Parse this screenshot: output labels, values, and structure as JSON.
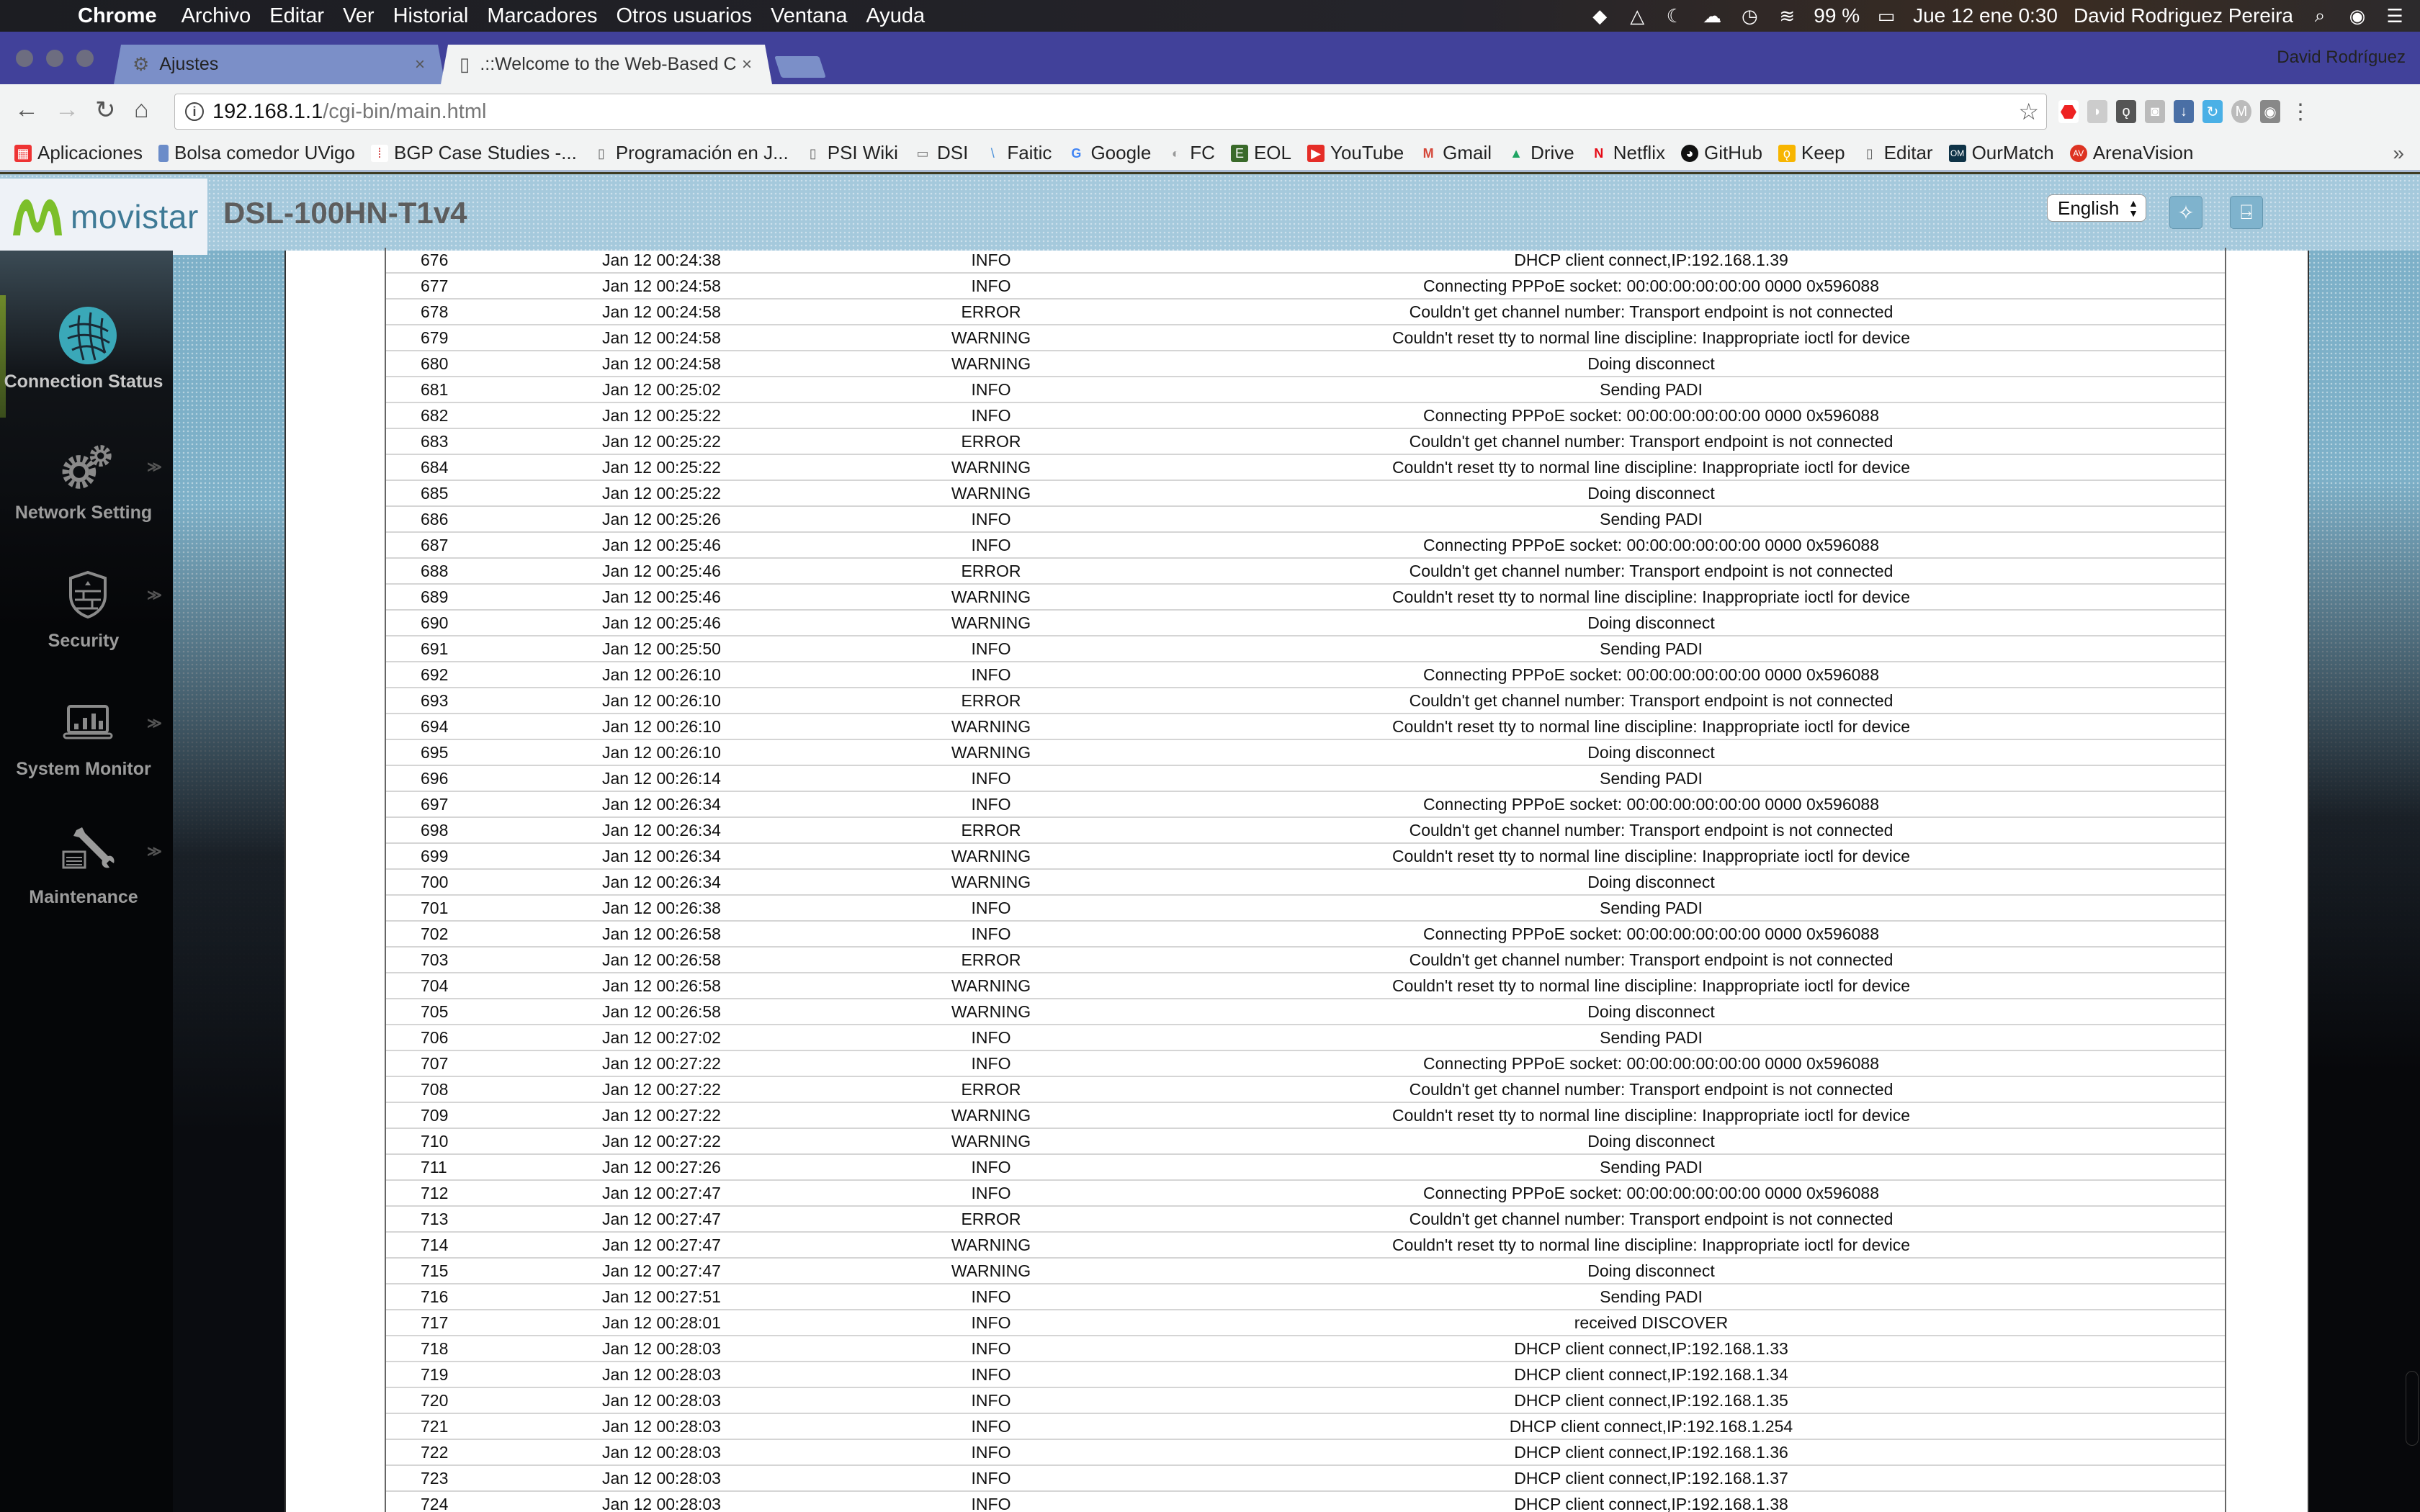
{
  "menubar": {
    "app": "Chrome",
    "items": [
      "Archivo",
      "Editar",
      "Ver",
      "Historial",
      "Marcadores",
      "Otros usuarios",
      "Ventana",
      "Ayuda"
    ],
    "battery": "99 %",
    "datetime": "Jue 12 ene  0:30",
    "user": "David Rodriguez Pereira"
  },
  "browser": {
    "tabs": [
      {
        "label": "Ajustes",
        "icon": "gear-icon",
        "active": false
      },
      {
        "label": ".::Welcome to the Web-Based C",
        "icon": "page-icon",
        "active": true
      }
    ],
    "profile_name": "David Rodríguez",
    "url_host": "192.168.1.1",
    "url_path": "/cgi-bin/main.html",
    "bookmarks": [
      {
        "label": "Aplicaciones",
        "icon": "apps-grid-icon",
        "color": "#e33"
      },
      {
        "label": "Bolsa comedor UVigo",
        "icon": "uvigo-icon",
        "color": "#6b8cc9"
      },
      {
        "label": "BGP Case Studies -...",
        "icon": "cisco-icon",
        "color": "#c33"
      },
      {
        "label": "Programación en J...",
        "icon": "page-icon",
        "color": "#999"
      },
      {
        "label": "PSI Wiki",
        "icon": "page-icon",
        "color": "#999"
      },
      {
        "label": "DSI",
        "icon": "folder-icon",
        "color": "#888"
      },
      {
        "label": "Faitic",
        "icon": "faitic-icon",
        "color": "#4a90d9"
      },
      {
        "label": "Google",
        "icon": "google-icon",
        "color": "#4285f4"
      },
      {
        "label": "FC",
        "icon": "fc-icon",
        "color": "#999"
      },
      {
        "label": "EOL",
        "icon": "eol-icon",
        "color": "#3a6a2a"
      },
      {
        "label": "YouTube",
        "icon": "youtube-icon",
        "color": "#e52d27"
      },
      {
        "label": "Gmail",
        "icon": "gmail-icon",
        "color": "#d44638"
      },
      {
        "label": "Drive",
        "icon": "drive-icon",
        "color": "#1fa463"
      },
      {
        "label": "Netflix",
        "icon": "netflix-icon",
        "color": "#e50914"
      },
      {
        "label": "GitHub",
        "icon": "github-icon",
        "color": "#111"
      },
      {
        "label": "Keep",
        "icon": "keep-icon",
        "color": "#f7b500"
      },
      {
        "label": "Editar",
        "icon": "page-icon",
        "color": "#999"
      },
      {
        "label": "OurMatch",
        "icon": "ourmatch-icon",
        "color": "#0f3347"
      },
      {
        "label": "ArenaVision",
        "icon": "arenavision-icon",
        "color": "#d32"
      }
    ]
  },
  "router": {
    "brand": "movistar",
    "model": "DSL-100HN-T1v4",
    "language": "English",
    "wizard_icon": "wizard-wand-icon",
    "logout_icon": "logout-door-icon",
    "sidebar": [
      {
        "label": "Connection Status",
        "icon": "globe-icon",
        "active": true
      },
      {
        "label": "Network Setting",
        "icon": "gears-icon",
        "active": false
      },
      {
        "label": "Security",
        "icon": "shield-firewall-icon",
        "active": false
      },
      {
        "label": "System Monitor",
        "icon": "laptop-chart-icon",
        "active": false
      },
      {
        "label": "Maintenance",
        "icon": "wrench-icon",
        "active": false
      }
    ],
    "log_rows": [
      {
        "id": "676",
        "time": "Jan 12 00:24:38",
        "level": "INFO",
        "message": "DHCP client connect,IP:192.168.1.39"
      },
      {
        "id": "677",
        "time": "Jan 12 00:24:58",
        "level": "INFO",
        "message": "Connecting PPPoE socket: 00:00:00:00:00:00 0000 0x596088"
      },
      {
        "id": "678",
        "time": "Jan 12 00:24:58",
        "level": "ERROR",
        "message": "Couldn't get channel number: Transport endpoint is not connected"
      },
      {
        "id": "679",
        "time": "Jan 12 00:24:58",
        "level": "WARNING",
        "message": "Couldn't reset tty to normal line discipline: Inappropriate ioctl for device"
      },
      {
        "id": "680",
        "time": "Jan 12 00:24:58",
        "level": "WARNING",
        "message": "Doing disconnect"
      },
      {
        "id": "681",
        "time": "Jan 12 00:25:02",
        "level": "INFO",
        "message": "Sending PADI"
      },
      {
        "id": "682",
        "time": "Jan 12 00:25:22",
        "level": "INFO",
        "message": "Connecting PPPoE socket: 00:00:00:00:00:00 0000 0x596088"
      },
      {
        "id": "683",
        "time": "Jan 12 00:25:22",
        "level": "ERROR",
        "message": "Couldn't get channel number: Transport endpoint is not connected"
      },
      {
        "id": "684",
        "time": "Jan 12 00:25:22",
        "level": "WARNING",
        "message": "Couldn't reset tty to normal line discipline: Inappropriate ioctl for device"
      },
      {
        "id": "685",
        "time": "Jan 12 00:25:22",
        "level": "WARNING",
        "message": "Doing disconnect"
      },
      {
        "id": "686",
        "time": "Jan 12 00:25:26",
        "level": "INFO",
        "message": "Sending PADI"
      },
      {
        "id": "687",
        "time": "Jan 12 00:25:46",
        "level": "INFO",
        "message": "Connecting PPPoE socket: 00:00:00:00:00:00 0000 0x596088"
      },
      {
        "id": "688",
        "time": "Jan 12 00:25:46",
        "level": "ERROR",
        "message": "Couldn't get channel number: Transport endpoint is not connected"
      },
      {
        "id": "689",
        "time": "Jan 12 00:25:46",
        "level": "WARNING",
        "message": "Couldn't reset tty to normal line discipline: Inappropriate ioctl for device"
      },
      {
        "id": "690",
        "time": "Jan 12 00:25:46",
        "level": "WARNING",
        "message": "Doing disconnect"
      },
      {
        "id": "691",
        "time": "Jan 12 00:25:50",
        "level": "INFO",
        "message": "Sending PADI"
      },
      {
        "id": "692",
        "time": "Jan 12 00:26:10",
        "level": "INFO",
        "message": "Connecting PPPoE socket: 00:00:00:00:00:00 0000 0x596088"
      },
      {
        "id": "693",
        "time": "Jan 12 00:26:10",
        "level": "ERROR",
        "message": "Couldn't get channel number: Transport endpoint is not connected"
      },
      {
        "id": "694",
        "time": "Jan 12 00:26:10",
        "level": "WARNING",
        "message": "Couldn't reset tty to normal line discipline: Inappropriate ioctl for device"
      },
      {
        "id": "695",
        "time": "Jan 12 00:26:10",
        "level": "WARNING",
        "message": "Doing disconnect"
      },
      {
        "id": "696",
        "time": "Jan 12 00:26:14",
        "level": "INFO",
        "message": "Sending PADI"
      },
      {
        "id": "697",
        "time": "Jan 12 00:26:34",
        "level": "INFO",
        "message": "Connecting PPPoE socket: 00:00:00:00:00:00 0000 0x596088"
      },
      {
        "id": "698",
        "time": "Jan 12 00:26:34",
        "level": "ERROR",
        "message": "Couldn't get channel number: Transport endpoint is not connected"
      },
      {
        "id": "699",
        "time": "Jan 12 00:26:34",
        "level": "WARNING",
        "message": "Couldn't reset tty to normal line discipline: Inappropriate ioctl for device"
      },
      {
        "id": "700",
        "time": "Jan 12 00:26:34",
        "level": "WARNING",
        "message": "Doing disconnect"
      },
      {
        "id": "701",
        "time": "Jan 12 00:26:38",
        "level": "INFO",
        "message": "Sending PADI"
      },
      {
        "id": "702",
        "time": "Jan 12 00:26:58",
        "level": "INFO",
        "message": "Connecting PPPoE socket: 00:00:00:00:00:00 0000 0x596088"
      },
      {
        "id": "703",
        "time": "Jan 12 00:26:58",
        "level": "ERROR",
        "message": "Couldn't get channel number: Transport endpoint is not connected"
      },
      {
        "id": "704",
        "time": "Jan 12 00:26:58",
        "level": "WARNING",
        "message": "Couldn't reset tty to normal line discipline: Inappropriate ioctl for device"
      },
      {
        "id": "705",
        "time": "Jan 12 00:26:58",
        "level": "WARNING",
        "message": "Doing disconnect"
      },
      {
        "id": "706",
        "time": "Jan 12 00:27:02",
        "level": "INFO",
        "message": "Sending PADI"
      },
      {
        "id": "707",
        "time": "Jan 12 00:27:22",
        "level": "INFO",
        "message": "Connecting PPPoE socket: 00:00:00:00:00:00 0000 0x596088"
      },
      {
        "id": "708",
        "time": "Jan 12 00:27:22",
        "level": "ERROR",
        "message": "Couldn't get channel number: Transport endpoint is not connected"
      },
      {
        "id": "709",
        "time": "Jan 12 00:27:22",
        "level": "WARNING",
        "message": "Couldn't reset tty to normal line discipline: Inappropriate ioctl for device"
      },
      {
        "id": "710",
        "time": "Jan 12 00:27:22",
        "level": "WARNING",
        "message": "Doing disconnect"
      },
      {
        "id": "711",
        "time": "Jan 12 00:27:26",
        "level": "INFO",
        "message": "Sending PADI"
      },
      {
        "id": "712",
        "time": "Jan 12 00:27:47",
        "level": "INFO",
        "message": "Connecting PPPoE socket: 00:00:00:00:00:00 0000 0x596088"
      },
      {
        "id": "713",
        "time": "Jan 12 00:27:47",
        "level": "ERROR",
        "message": "Couldn't get channel number: Transport endpoint is not connected"
      },
      {
        "id": "714",
        "time": "Jan 12 00:27:47",
        "level": "WARNING",
        "message": "Couldn't reset tty to normal line discipline: Inappropriate ioctl for device"
      },
      {
        "id": "715",
        "time": "Jan 12 00:27:47",
        "level": "WARNING",
        "message": "Doing disconnect"
      },
      {
        "id": "716",
        "time": "Jan 12 00:27:51",
        "level": "INFO",
        "message": "Sending PADI"
      },
      {
        "id": "717",
        "time": "Jan 12 00:28:01",
        "level": "INFO",
        "message": "received DISCOVER"
      },
      {
        "id": "718",
        "time": "Jan 12 00:28:03",
        "level": "INFO",
        "message": "DHCP client connect,IP:192.168.1.33"
      },
      {
        "id": "719",
        "time": "Jan 12 00:28:03",
        "level": "INFO",
        "message": "DHCP client connect,IP:192.168.1.34"
      },
      {
        "id": "720",
        "time": "Jan 12 00:28:03",
        "level": "INFO",
        "message": "DHCP client connect,IP:192.168.1.35"
      },
      {
        "id": "721",
        "time": "Jan 12 00:28:03",
        "level": "INFO",
        "message": "DHCP client connect,IP:192.168.1.254"
      },
      {
        "id": "722",
        "time": "Jan 12 00:28:03",
        "level": "INFO",
        "message": "DHCP client connect,IP:192.168.1.36"
      },
      {
        "id": "723",
        "time": "Jan 12 00:28:03",
        "level": "INFO",
        "message": "DHCP client connect,IP:192.168.1.37"
      },
      {
        "id": "724",
        "time": "Jan 12 00:28:03",
        "level": "INFO",
        "message": "DHCP client connect,IP:192.168.1.38"
      }
    ]
  }
}
